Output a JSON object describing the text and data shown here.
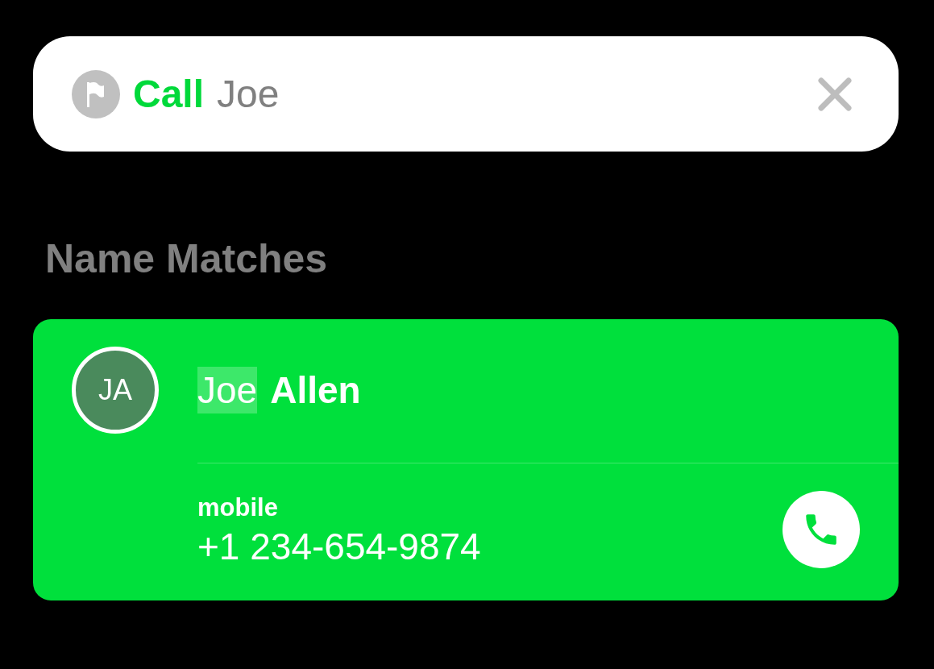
{
  "search": {
    "command": "Call",
    "query": "Joe"
  },
  "section_title": "Name Matches",
  "contacts": [
    {
      "initials": "JA",
      "name_parts": [
        {
          "text": "Joe",
          "matched": true
        },
        {
          "text": "Allen",
          "matched": false
        }
      ],
      "label": "mobile",
      "phone": "+1 234-654-9874"
    }
  ]
}
